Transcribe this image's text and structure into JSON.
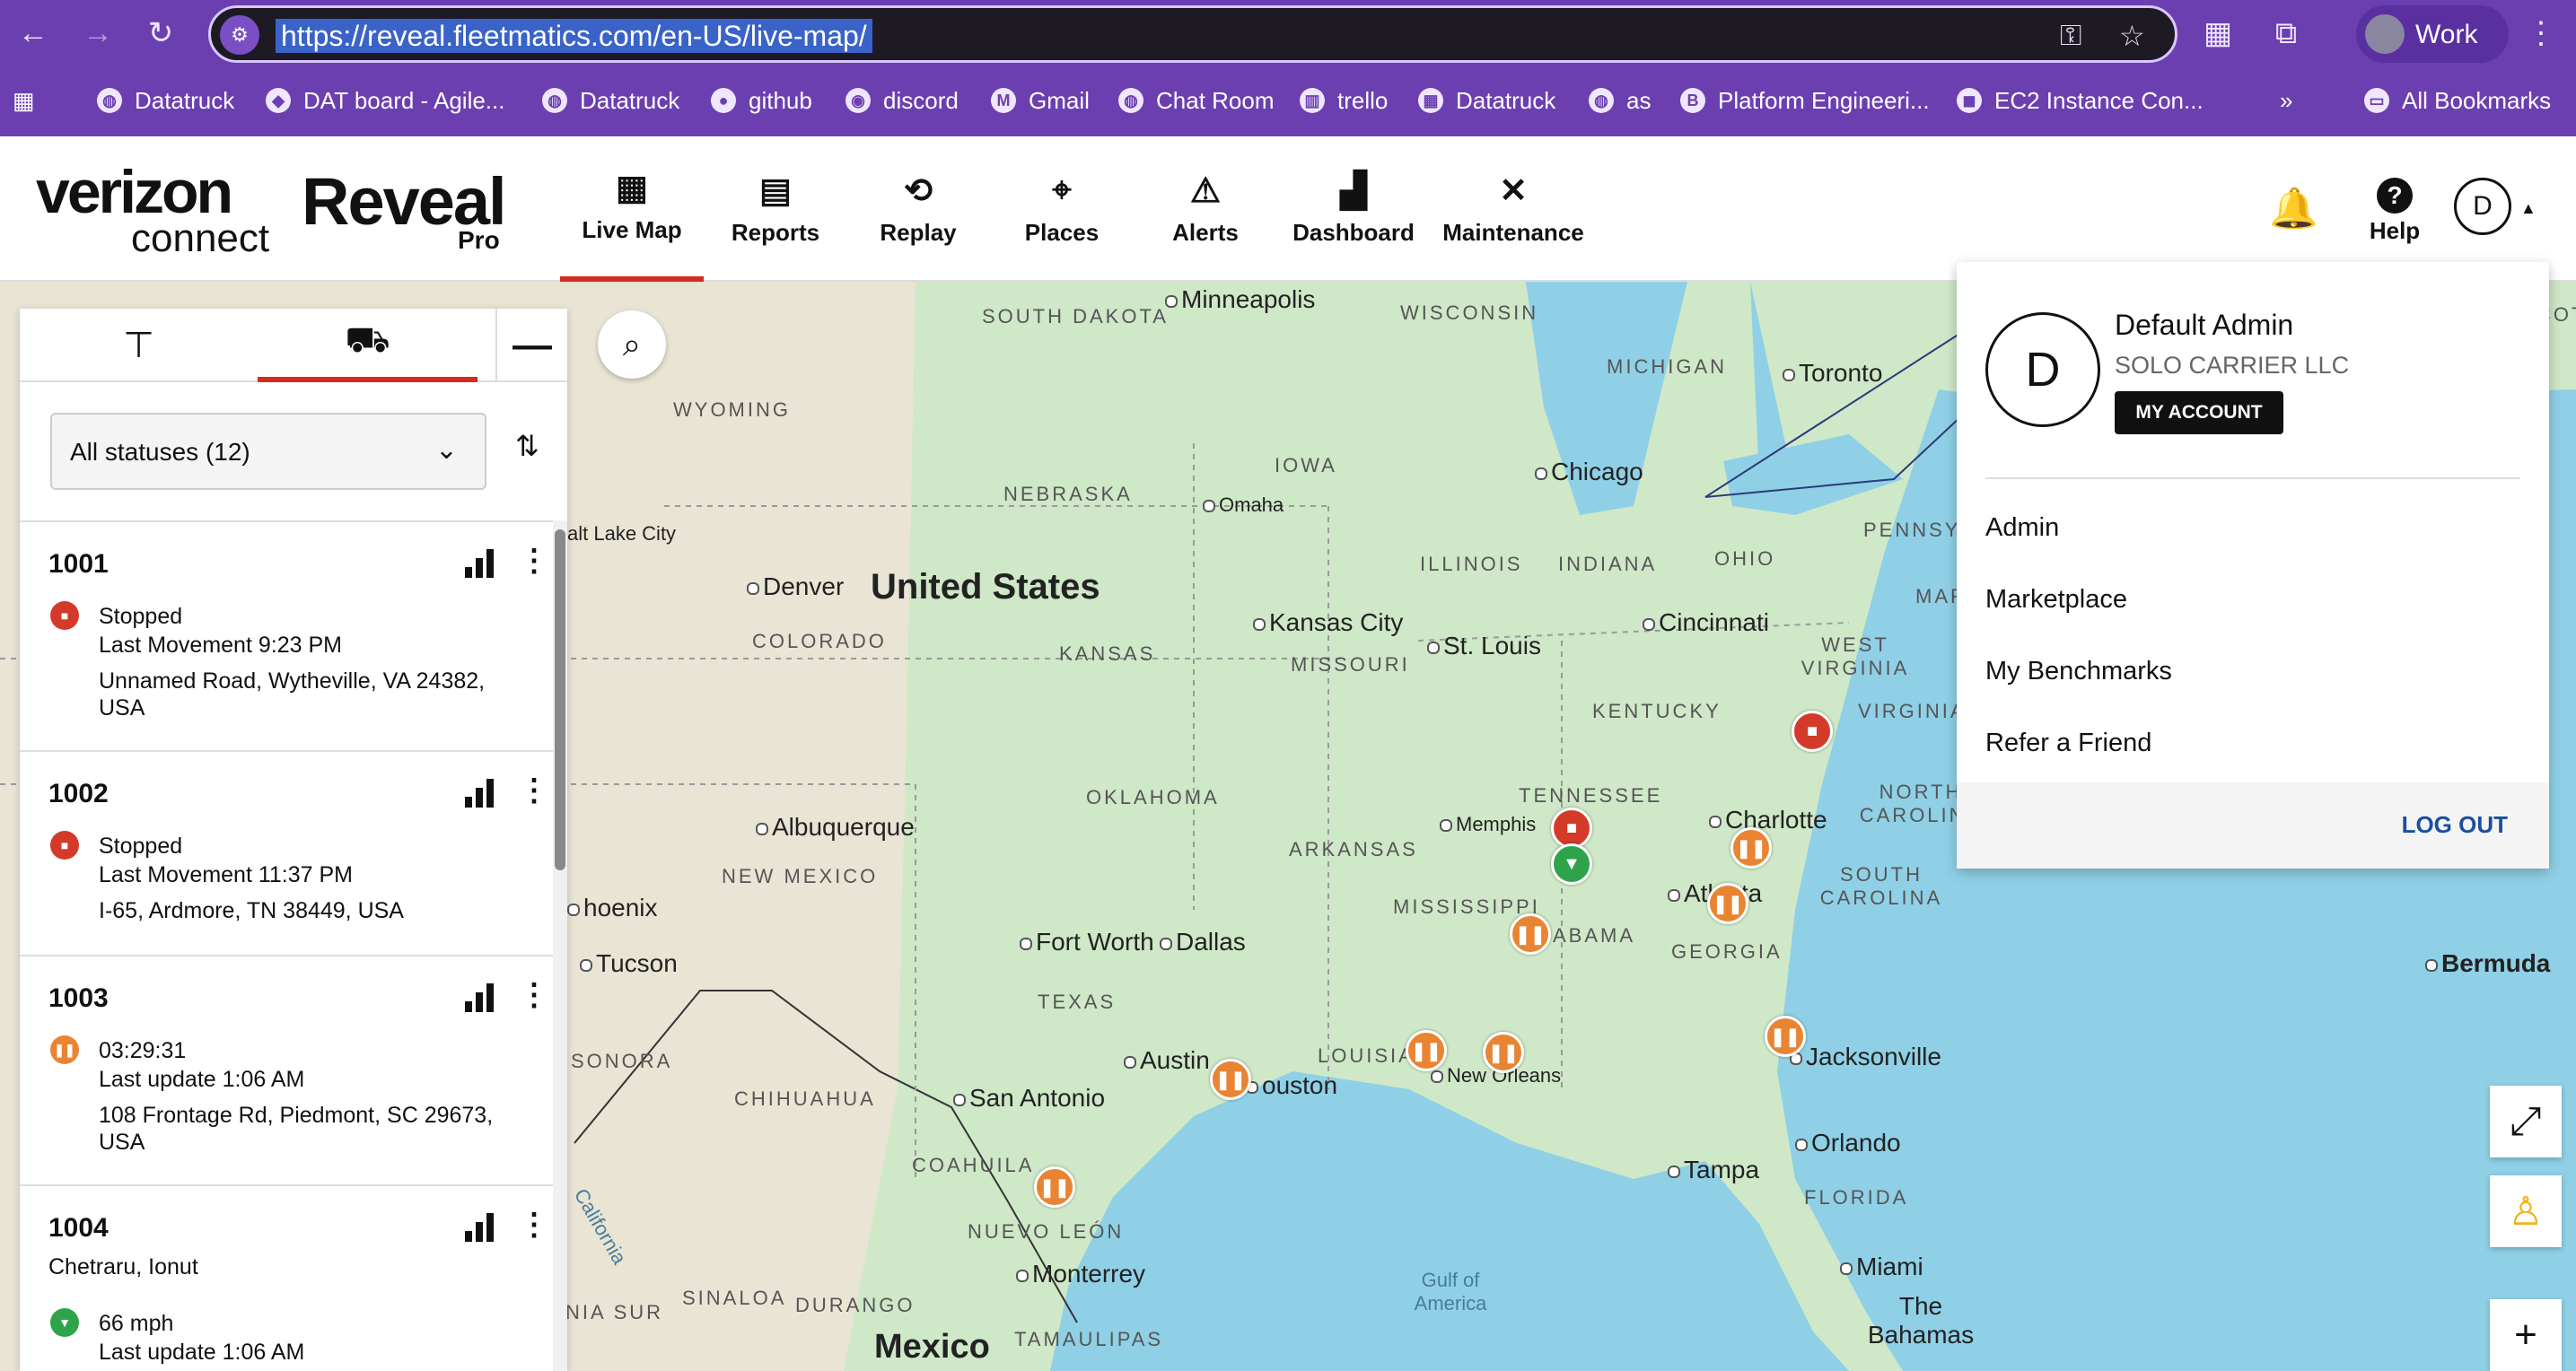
{
  "browser": {
    "url": "https://reveal.fleetmatics.com/en-US/live-map/",
    "profile_label": "Work",
    "bookmarks": [
      {
        "label": "Datatruck"
      },
      {
        "label": "DAT board - Agile..."
      },
      {
        "label": "Datatruck"
      },
      {
        "label": "github"
      },
      {
        "label": "discord"
      },
      {
        "label": "Gmail"
      },
      {
        "label": "Chat Room"
      },
      {
        "label": "trello"
      },
      {
        "label": "Datatruck"
      },
      {
        "label": "as"
      },
      {
        "label": "Platform Engineeri..."
      },
      {
        "label": "EC2 Instance Con..."
      }
    ],
    "all_bookmarks_label": "All Bookmarks",
    "overflow_label": "»"
  },
  "header": {
    "logo_verizon": "verizon",
    "logo_connect": "connect",
    "logo_reveal": "Reveal",
    "logo_pro": "Pro",
    "tabs": [
      {
        "label": "Live Map",
        "icon": "live-map-icon"
      },
      {
        "label": "Reports",
        "icon": "reports-icon"
      },
      {
        "label": "Replay",
        "icon": "replay-icon"
      },
      {
        "label": "Places",
        "icon": "places-icon"
      },
      {
        "label": "Alerts",
        "icon": "alerts-icon"
      },
      {
        "label": "Dashboard",
        "icon": "dashboard-icon"
      },
      {
        "label": "Maintenance",
        "icon": "maintenance-icon"
      }
    ],
    "active_tab": "Live Map",
    "help_label": "Help",
    "avatar_initial": "D"
  },
  "panel": {
    "status_filter": "All statuses (12)",
    "vehicles": [
      {
        "id": "1001",
        "status": "Stopped",
        "status_type": "stopped",
        "detail": "Last Movement 9:23 PM",
        "address": "Unnamed Road, Wytheville, VA 24382, USA"
      },
      {
        "id": "1002",
        "status": "Stopped",
        "status_type": "stopped",
        "detail": "Last Movement 11:37 PM",
        "address": "I-65, Ardmore, TN 38449, USA"
      },
      {
        "id": "1003",
        "status": "03:29:31",
        "status_type": "idle",
        "detail": "Last update 1:06 AM",
        "address": "108 Frontage Rd, Piedmont, SC 29673, USA"
      },
      {
        "id": "1004",
        "driver": "Chetraru, Ionut",
        "status": "66 mph",
        "status_type": "moving",
        "detail": "Last update 1:06 AM"
      }
    ]
  },
  "account_menu": {
    "initial": "D",
    "name": "Default Admin",
    "company": "SOLO CARRIER LLC",
    "my_account_label": "MY ACCOUNT",
    "items": [
      "Admin",
      "Marketplace",
      "My Benchmarks",
      "Refer a Friend"
    ],
    "logout_label": "LOG OUT"
  },
  "map": {
    "country_label": "United States",
    "mexico_label": "Mexico",
    "states": [
      "SOUTH DAKOTA",
      "WISCONSIN",
      "MICHIGAN",
      "WYOMING",
      "IOWA",
      "NEBRASKA",
      "ILLINOIS",
      "INDIANA",
      "OHIO",
      "PENNSYL",
      "COLORADO",
      "KANSAS",
      "MISSOURI",
      "WEST VIRGINIA",
      "KENTUCKY",
      "VIRGINIA",
      "TENNESSEE",
      "NORTH CAROLINA",
      "OKLAHOMA",
      "ARKANSAS",
      "SOUTH CAROLINA",
      "NEW MEXICO",
      "MISSISSIPPI",
      "ABAMA",
      "GEORGIA",
      "TEXAS",
      "LOUISIA",
      "SONORA",
      "CHIHUAHUA",
      "COAHUILA",
      "NUEVO LEÓN",
      "SINALOA",
      "DURANGO",
      "TAMAULIPAS",
      "FLORIDA",
      "NIA SUR",
      "MAR"
    ],
    "cities": [
      "Minneapolis",
      "Toronto",
      "Chicago",
      "Omaha",
      "alt Lake City",
      "Denver",
      "Kansas City",
      "St. Louis",
      "Cincinnati",
      "Memphis",
      "Charlotte",
      "Albuquerque",
      "Atlanta",
      "hoenix",
      "Tucson",
      "Fort Worth",
      "Dallas",
      "Austin",
      "ouston",
      "San Antonio",
      "New Orleans",
      "Jacksonville",
      "Orlando",
      "Tampa",
      "Miami",
      "Monterrey"
    ],
    "water": [
      "Gulf of America",
      "Bermuda",
      "The Bahamas",
      "California",
      "COT"
    ],
    "markers": [
      {
        "type": "stopped",
        "label": "stopped-marker"
      },
      {
        "type": "stopped",
        "label": "stopped-marker"
      },
      {
        "type": "moving",
        "label": "moving-marker"
      },
      {
        "type": "idle",
        "label": "idle-marker"
      }
    ]
  }
}
